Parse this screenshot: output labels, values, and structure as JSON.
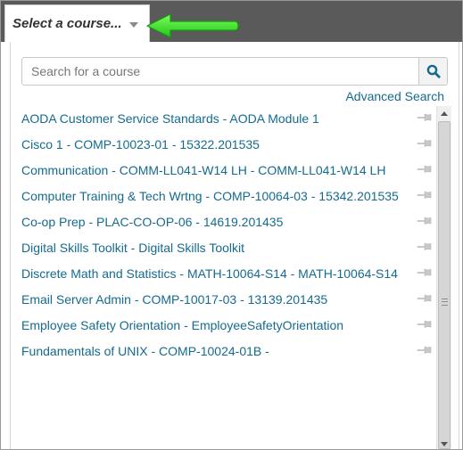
{
  "selector": {
    "label": "Select a course...",
    "caret_icon": "caret-down-icon"
  },
  "annotation": {
    "arrow_color": "#33dd22",
    "icon": "arrow-left-icon"
  },
  "search": {
    "placeholder": "Search for a course",
    "value": "",
    "button_icon": "search-icon"
  },
  "advanced_search_label": "Advanced Search",
  "colors": {
    "link": "#146b8f",
    "topbar": "#5a5a5a",
    "pin": "#c8c8c8"
  },
  "courses": [
    {
      "label": "AODA Customer Service Standards - AODA Module 1",
      "pin_icon": "pin-icon"
    },
    {
      "label": "Cisco 1 - COMP-10023-01 - 15322.201535",
      "pin_icon": "pin-icon"
    },
    {
      "label": "Communication - COMM-LL041-W14 LH - COMM-LL041-W14 LH",
      "pin_icon": "pin-icon"
    },
    {
      "label": "Computer Training & Tech Wrtng - COMP-10064-03 - 15342.201535",
      "pin_icon": "pin-icon"
    },
    {
      "label": "Co-op Prep - PLAC-CO-OP-06 - 14619.201435",
      "pin_icon": "pin-icon"
    },
    {
      "label": "Digital Skills Toolkit - Digital Skills Toolkit",
      "pin_icon": "pin-icon"
    },
    {
      "label": "Discrete Math and Statistics - MATH-10064-S14 - MATH-10064-S14",
      "pin_icon": "pin-icon"
    },
    {
      "label": "Email Server Admin - COMP-10017-03 - 13139.201435",
      "pin_icon": "pin-icon"
    },
    {
      "label": "Employee Safety Orientation - EmployeeSafetyOrientation",
      "pin_icon": "pin-icon"
    },
    {
      "label": "Fundamentals of UNIX - COMP-10024-01B -",
      "pin_icon": "pin-icon"
    }
  ]
}
